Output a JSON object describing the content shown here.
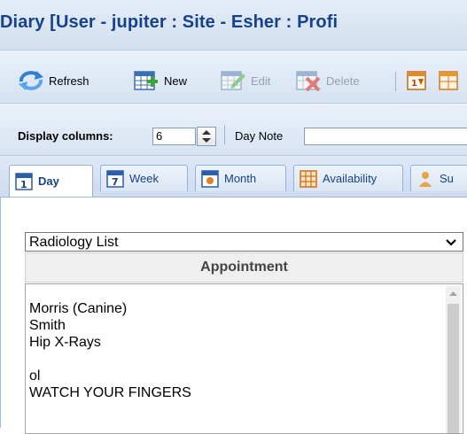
{
  "window": {
    "title": "Diary [User - jupiter : Site - Esher : Profi"
  },
  "toolbar": {
    "refresh_label": "Refresh",
    "new_label": "New",
    "edit_label": "Edit",
    "delete_label": "Delete"
  },
  "options": {
    "display_columns_label": "Display columns:",
    "display_columns_value": "6",
    "day_note_label": "Day Note",
    "day_note_value": ""
  },
  "tabs": [
    {
      "label": "Day",
      "active": true
    },
    {
      "label": "Week",
      "active": false
    },
    {
      "label": "Month",
      "active": false
    },
    {
      "label": "Availability",
      "active": false
    },
    {
      "label": "Su",
      "active": false
    }
  ],
  "diary": {
    "list_selected": "Radiology List",
    "column_header": "Appointment",
    "appointment_lines": [
      "Morris (Canine)",
      "Smith",
      "Hip X-Rays",
      "",
      "ol",
      "WATCH YOUR FINGERS"
    ]
  },
  "icons": {
    "refresh": "refresh-icon",
    "new": "new-appointment-icon",
    "edit": "edit-appointment-icon",
    "delete": "delete-appointment-icon",
    "calendar": "calendar-icon"
  },
  "colors": {
    "title_text": "#15428b",
    "tab_border": "#8db2e3",
    "toolbar_bg": "#dfe8f6"
  }
}
